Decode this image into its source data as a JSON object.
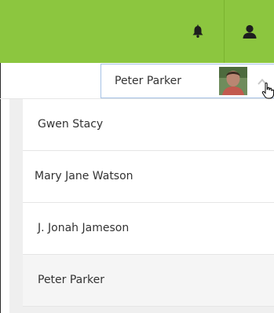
{
  "header": {
    "background": "#8cc63f",
    "icons": [
      "bell-icon",
      "user-icon"
    ]
  },
  "account_selector": {
    "current_user": "Peter Parker",
    "state": "expanded"
  },
  "menu": {
    "items": [
      {
        "label": "Gwen Stacy"
      },
      {
        "label": "Mary Jane Watson"
      },
      {
        "label": "J. Jonah Jameson"
      },
      {
        "label": "Peter Parker"
      }
    ]
  }
}
